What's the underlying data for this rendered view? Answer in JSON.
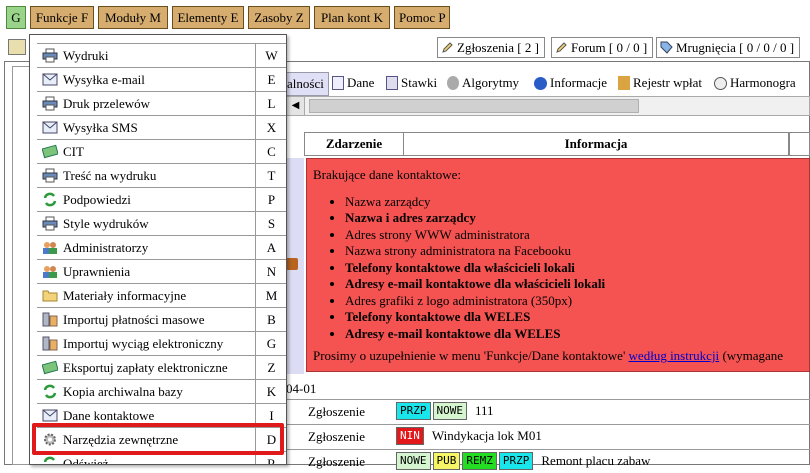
{
  "menubar": {
    "buttons": [
      "G",
      "Funkcje F",
      "Moduły M",
      "Elementy E",
      "Zasoby Z",
      "Plan kont K",
      "Pomoc P"
    ]
  },
  "notifications": {
    "zgloszenia": "Zgłoszenia [ 2 ]",
    "forum": "Forum [ 0 / 0 ]",
    "mrugniecia": "Mrugnięcia [ 0 / 0 / 0 ]"
  },
  "subtabs": {
    "selected_fragment": "alności",
    "items": [
      "Dane",
      "Stawki",
      "Algorytmy",
      "Informacje",
      "Rejestr wpłat",
      "Harmonogra"
    ]
  },
  "table": {
    "headers": [
      "Zdarzenie",
      "Informacja"
    ],
    "alert": {
      "intro": "Brakujące dane kontaktowe:",
      "items": [
        {
          "text": "Nazwa zarządcy",
          "bold": false
        },
        {
          "text": "Nazwa i adres zarządcy",
          "bold": true
        },
        {
          "text": "Adres strony WWW administratora",
          "bold": false
        },
        {
          "text": "Nazwa strony administratora na Facebooku",
          "bold": false
        },
        {
          "text": "Telefony kontaktowe dla właścicieli lokali",
          "bold": true
        },
        {
          "text": "Adresy e-mail kontaktowe dla właścicieli lokali",
          "bold": true
        },
        {
          "text": "Adres grafiki z logo administratora (350px)",
          "bold": false
        },
        {
          "text": "Telefony kontaktowe dla WELES",
          "bold": true
        },
        {
          "text": "Adresy e-mail kontaktowe dla WELES",
          "bold": true
        }
      ],
      "footer_prefix": "Prosimy o uzupełnienie w menu 'Funkcje/Dane kontaktowe'",
      "footer_link": "według instrukcji",
      "footer_suffix": "(wymagane"
    },
    "date_fragment": "04-01",
    "rows": [
      {
        "zdarzenie": "Zgłoszenie",
        "tags": [
          {
            "t": "PRZP",
            "c": "#19e6ea"
          },
          {
            "t": "NOWE",
            "c": "#d5f5cf"
          }
        ],
        "text": "111"
      },
      {
        "zdarzenie": "Zgłoszenie",
        "tags": [
          {
            "t": "NIN",
            "c": "#e3181a"
          }
        ],
        "text": "Windykacja lok M01"
      },
      {
        "zdarzenie": "Zgłoszenie",
        "tags": [
          {
            "t": "NOWE",
            "c": "#d5f5cf"
          },
          {
            "t": "PUB",
            "c": "#f5f566"
          },
          {
            "t": "REMZ",
            "c": "#22dd22"
          },
          {
            "t": "PRZP",
            "c": "#19e6ea"
          }
        ],
        "text": "Remont placu zabaw"
      }
    ]
  },
  "dropdown": {
    "items": [
      {
        "label": "Wydruki",
        "key": "W",
        "icon": "printer-icon"
      },
      {
        "label": "Wysyłka e-mail",
        "key": "E",
        "icon": "envelope-icon"
      },
      {
        "label": "Druk przelewów",
        "key": "L",
        "icon": "printer-icon"
      },
      {
        "label": "Wysyłka SMS",
        "key": "X",
        "icon": "envelope-icon"
      },
      {
        "label": "CIT",
        "key": "C",
        "icon": "money-icon"
      },
      {
        "label": "Treść na wydruku",
        "key": "T",
        "icon": "printer-icon"
      },
      {
        "label": "Podpowiedzi",
        "key": "P",
        "icon": "recycle-icon"
      },
      {
        "label": "Style wydruków",
        "key": "S",
        "icon": "printer-icon"
      },
      {
        "label": "Administratorzy",
        "key": "A",
        "icon": "users-icon"
      },
      {
        "label": "Uprawnienia",
        "key": "N",
        "icon": "users-icon"
      },
      {
        "label": "Materiały informacyjne",
        "key": "M",
        "icon": "folder-icon"
      },
      {
        "label": "Importuj płatności masowe",
        "key": "B",
        "icon": "import-icon"
      },
      {
        "label": "Importuj wyciąg elektroniczny",
        "key": "G",
        "icon": "import-icon"
      },
      {
        "label": "Eksportuj zapłaty elektroniczne",
        "key": "Z",
        "icon": "money-icon"
      },
      {
        "label": "Kopia archiwalna bazy",
        "key": "K",
        "icon": "recycle-icon"
      },
      {
        "label": "Dane kontaktowe",
        "key": "I",
        "icon": "envelope-icon"
      },
      {
        "label": "Narzędzia zewnętrzne",
        "key": "D",
        "icon": "gear-icon"
      },
      {
        "label": "Odśwież",
        "key": "R",
        "icon": "recycle-icon"
      }
    ]
  },
  "colors": {
    "menu_button": "#d6ad6e",
    "menu_button_g": "#9ad38a",
    "alert_bg": "#f45352",
    "highlight": "#e0191a"
  }
}
